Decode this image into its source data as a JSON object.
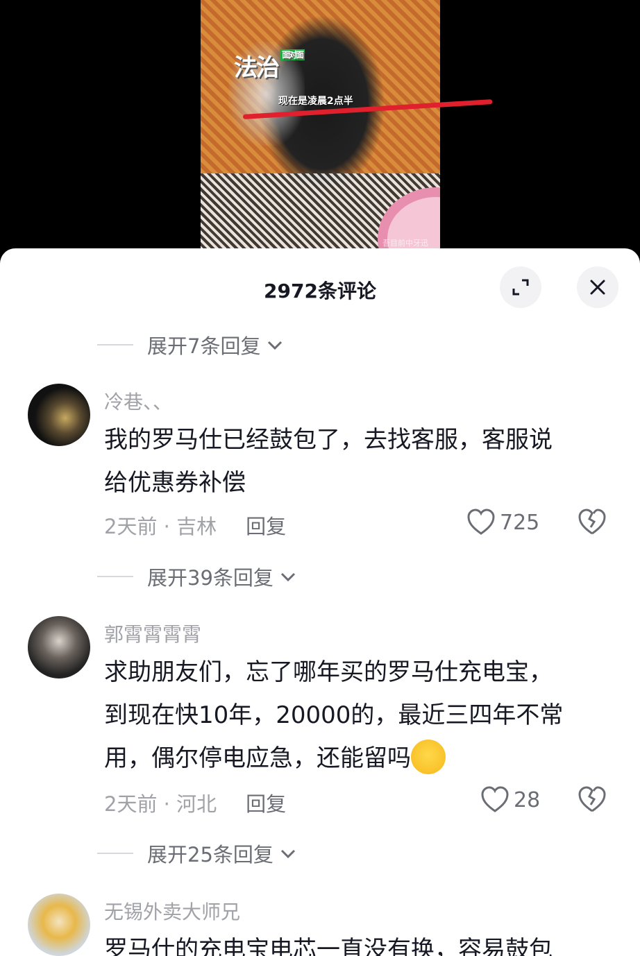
{
  "video": {
    "logo_text": "法治",
    "logo_badge": "面对面",
    "caption": "现在是凌晨2点半",
    "watermark": "吾目前中牙迅"
  },
  "sheet": {
    "title": "2972条评论"
  },
  "reply_toggles": [
    {
      "label": "展开7条回复"
    },
    {
      "label": "展开39条回复"
    },
    {
      "label": "展开25条回复"
    }
  ],
  "comments": [
    {
      "username": "冷巷、、",
      "line1": "我的罗马仕已经鼓包了，去找客服，客服说",
      "line2": "给优惠券补偿",
      "time_location": "2天前 · 吉林",
      "reply_label": "回复",
      "likes": "725"
    },
    {
      "username": "郭霄霄霄霄",
      "line1": "求助朋友们，忘了哪年买的罗马仕充电宝，",
      "line2": "到现在快10年，20000的，最近三四年不常",
      "line3": "用，偶尔停电应急，还能留吗",
      "emoji": "crying-face",
      "time_location": "2天前 · 河北",
      "reply_label": "回复",
      "likes": "28"
    },
    {
      "username": "无锡外卖大师兄",
      "line1": "罗马仕的充电宝电芯一直没有换，容易鼓包"
    }
  ],
  "colors": {
    "sheet_bg": "#ffffff",
    "text_primary": "#161823",
    "text_secondary": "#a1a2a8",
    "highlight_line": "#e0202c"
  }
}
